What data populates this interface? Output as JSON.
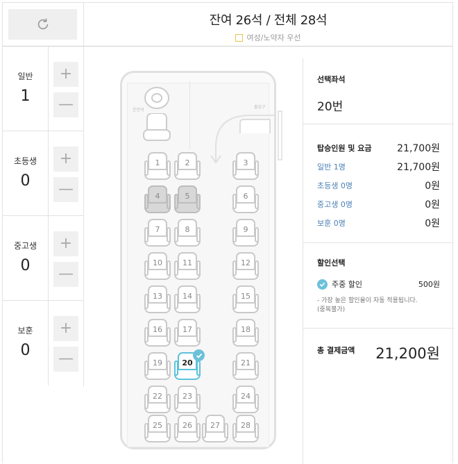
{
  "header": {
    "title": "잔여 26석 / 전체 28석",
    "legend_label": "여성/노약자 우선"
  },
  "passengers": [
    {
      "name": "일반",
      "count": "1"
    },
    {
      "name": "초등생",
      "count": "0"
    },
    {
      "name": "중고생",
      "count": "0"
    },
    {
      "name": "보훈",
      "count": "0"
    }
  ],
  "bus": {
    "driver_label": "운전석",
    "door_label": "출입구",
    "seats": {
      "1": "1",
      "2": "2",
      "3": "3",
      "4": "4",
      "5": "5",
      "6": "6",
      "7": "7",
      "8": "8",
      "9": "9",
      "10": "10",
      "11": "11",
      "12": "12",
      "13": "13",
      "14": "14",
      "15": "15",
      "16": "16",
      "17": "17",
      "18": "18",
      "19": "19",
      "20": "20",
      "21": "21",
      "22": "22",
      "23": "23",
      "24": "24",
      "25": "25",
      "26": "26",
      "27": "27",
      "28": "28"
    },
    "occupied": [
      "4",
      "5"
    ],
    "selected": [
      "20"
    ]
  },
  "summary": {
    "selected_title": "선택좌석",
    "selected_seat": "20번",
    "fare_title": "탑승인원 및 요금",
    "fare_total": "21,700원",
    "fares": [
      {
        "label": "일반 1명",
        "value": "21,700원"
      },
      {
        "label": "초등생 0명",
        "value": "0원"
      },
      {
        "label": "중고생 0명",
        "value": "0원"
      },
      {
        "label": "보훈 0명",
        "value": "0원"
      }
    ],
    "discount_title": "할인선택",
    "discount_name": "주중 할인",
    "discount_amount": "500원",
    "discount_note": "- 가장 높은 할인율이 자동 적용됩니다.",
    "discount_note2": "(중복불가)",
    "total_label": "총 결제금액",
    "total_value": "21,200원"
  },
  "colors": {
    "accent": "#6cc1da",
    "link": "#4a7fb5",
    "priority_legend": "#e6c34a"
  }
}
